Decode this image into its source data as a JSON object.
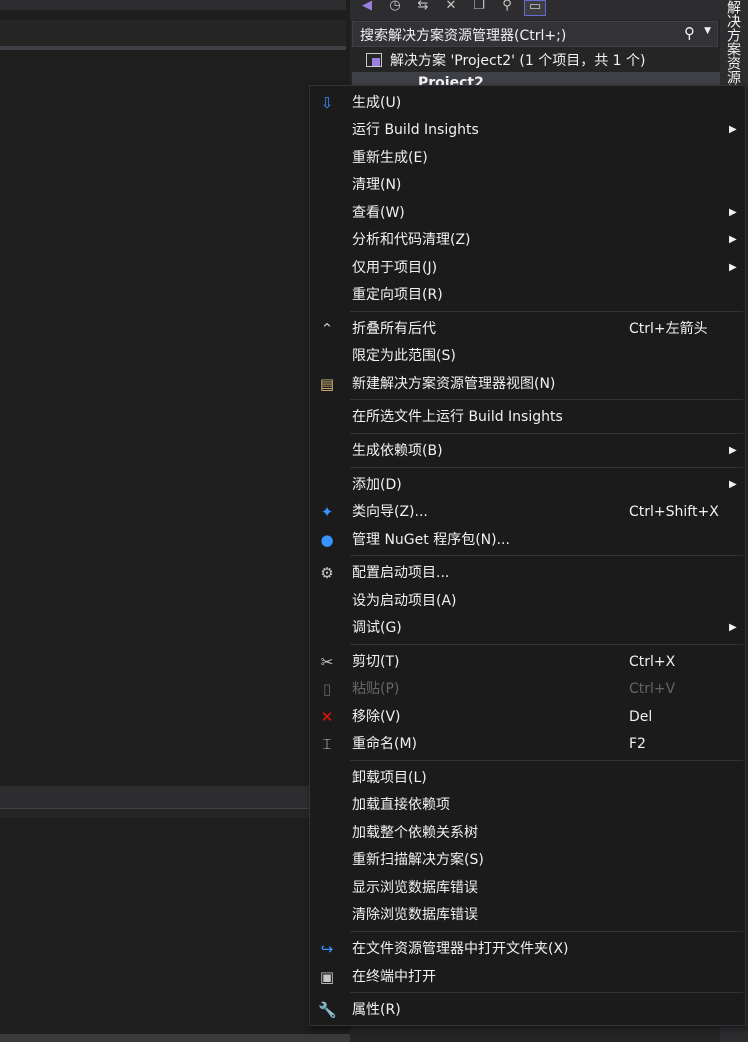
{
  "solution_explorer": {
    "search_placeholder": "搜索解决方案资源管理器(Ctrl+;)",
    "solution_row": "解决方案 'Project2' (1 个项目，共 1 个)",
    "project_row": "Project2",
    "side_tab_label": "解决方案资源管理器"
  },
  "context_menu": {
    "build": "生成(U)",
    "run_build_insights": "运行 Build Insights",
    "rebuild": "重新生成(E)",
    "clean": "清理(N)",
    "view": "查看(W)",
    "analyze": "分析和代码清理(Z)",
    "project_only": "仅用于项目(J)",
    "retarget": "重定向项目(R)",
    "collapse_all": "折叠所有后代",
    "collapse_all_shortcut": "Ctrl+左箭头",
    "scope_to_this": "限定为此范围(S)",
    "new_view": "新建解决方案资源管理器视图(N)",
    "run_build_insights_on_selection": "在所选文件上运行 Build Insights",
    "build_dependencies": "生成依赖项(B)",
    "add": "添加(D)",
    "class_wizard": "类向导(Z)...",
    "class_wizard_shortcut": "Ctrl+Shift+X",
    "manage_nuget": "管理 NuGet 程序包(N)...",
    "configure_startup": "配置启动项目...",
    "set_startup": "设为启动项目(A)",
    "debug": "调试(G)",
    "cut": "剪切(T)",
    "cut_shortcut": "Ctrl+X",
    "paste": "粘贴(P)",
    "paste_shortcut": "Ctrl+V",
    "remove": "移除(V)",
    "remove_shortcut": "Del",
    "rename": "重命名(M)",
    "rename_shortcut": "F2",
    "unload_project": "卸载项目(L)",
    "load_direct_deps": "加载直接依赖项",
    "load_dep_tree": "加载整个依赖关系树",
    "rescan_solution": "重新扫描解决方案(S)",
    "show_browse_db_errors": "显示浏览数据库错误",
    "clear_browse_db_errors": "清除浏览数据库错误",
    "open_in_explorer": "在文件资源管理器中打开文件夹(X)",
    "open_in_terminal": "在终端中打开",
    "properties": "属性(R)"
  }
}
